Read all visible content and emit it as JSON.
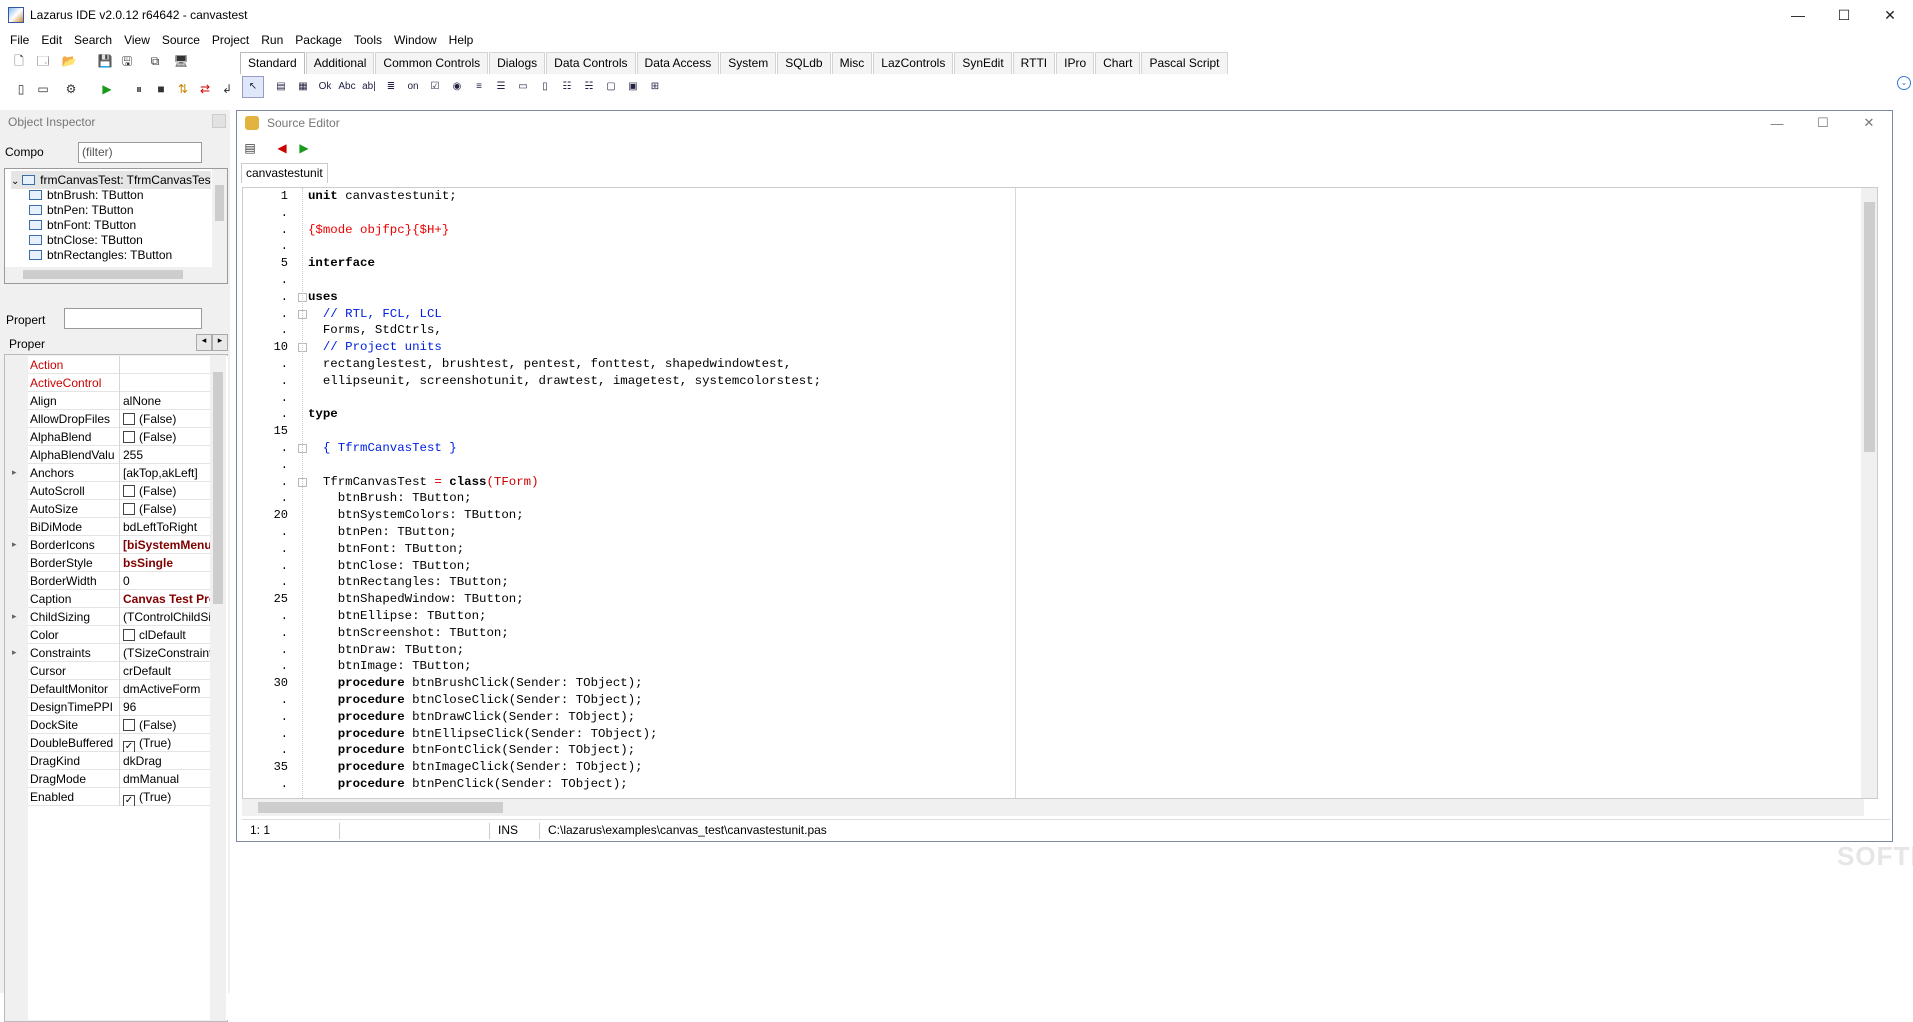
{
  "window": {
    "title": "Lazarus IDE v2.0.12 r64642 - canvastest",
    "min": "—",
    "max": "☐",
    "close": "✕"
  },
  "menu": [
    "File",
    "Edit",
    "Search",
    "View",
    "Source",
    "Project",
    "Run",
    "Package",
    "Tools",
    "Window",
    "Help"
  ],
  "palette": {
    "tabs": [
      "Standard",
      "Additional",
      "Common Controls",
      "Dialogs",
      "Data Controls",
      "Data Access",
      "System",
      "SQLdb",
      "Misc",
      "LazControls",
      "SynEdit",
      "RTTI",
      "IPro",
      "Chart",
      "Pascal Script"
    ],
    "icons": [
      "arrow-cursor-icon",
      "tmainmenu-icon",
      "tpopupmenu-icon",
      "tbutton-icon",
      "tlabel-icon",
      "tedit-icon",
      "tmemo-icon",
      "ttogglebox-icon",
      "tcheckbox-icon",
      "tradiobutton-icon",
      "tlistbox-icon",
      "tcombobox-icon",
      "tscrollbar-icon",
      "tgroupbox-icon",
      "tradiogroup-icon",
      "tcheckgroup-icon",
      "tpanel-icon",
      "tframe-icon",
      "tactionlist-icon"
    ],
    "icon_glyphs": [
      "↖",
      "▤",
      "▦",
      "Ok",
      "Abc",
      "ab|",
      "≣",
      "on",
      "☑",
      "◉",
      "≡",
      "☰",
      "▭",
      "▯",
      "☷",
      "☵",
      "▢",
      "▣",
      "⊞"
    ]
  },
  "object_inspector": {
    "title": "Object Inspector",
    "components_label": "Compo",
    "filter_placeholder": "(filter)",
    "properties_label": "Propert",
    "tab_label": "Proper",
    "tree": [
      "frmCanvasTest: TfrmCanvasTes",
      "btnBrush: TButton",
      "btnPen: TButton",
      "btnFont: TButton",
      "btnClose: TButton",
      "btnRectangles: TButton"
    ],
    "properties": [
      {
        "name": "Action",
        "value": "",
        "style": "red"
      },
      {
        "name": "ActiveControl",
        "value": "",
        "style": "red"
      },
      {
        "name": "Align",
        "value": "alNone"
      },
      {
        "name": "AllowDropFiles",
        "value": "(False)",
        "check": false
      },
      {
        "name": "AlphaBlend",
        "value": "(False)",
        "check": false
      },
      {
        "name": "AlphaBlendValu",
        "value": "255"
      },
      {
        "name": "Anchors",
        "value": "[akTop,akLeft]",
        "expand": true
      },
      {
        "name": "AutoScroll",
        "value": "(False)",
        "check": false
      },
      {
        "name": "AutoSize",
        "value": "(False)",
        "check": false
      },
      {
        "name": "BiDiMode",
        "value": "bdLeftToRight"
      },
      {
        "name": "BorderIcons",
        "value": "[biSystemMenu",
        "expand": true,
        "bold": true
      },
      {
        "name": "BorderStyle",
        "value": "bsSingle",
        "bold": true
      },
      {
        "name": "BorderWidth",
        "value": "0"
      },
      {
        "name": "Caption",
        "value": "Canvas Test Prog",
        "bold": true
      },
      {
        "name": "ChildSizing",
        "value": "(TControlChildSi",
        "expand": true
      },
      {
        "name": "Color",
        "value": "clDefault",
        "swatch": true
      },
      {
        "name": "Constraints",
        "value": "(TSizeConstraint",
        "expand": true
      },
      {
        "name": "Cursor",
        "value": "crDefault"
      },
      {
        "name": "DefaultMonitor",
        "value": "dmActiveForm"
      },
      {
        "name": "DesignTimePPI",
        "value": "96"
      },
      {
        "name": "DockSite",
        "value": "(False)",
        "check": false
      },
      {
        "name": "DoubleBuffered",
        "value": "(True)",
        "check": true
      },
      {
        "name": "DragKind",
        "value": "dkDrag"
      },
      {
        "name": "DragMode",
        "value": "dmManual"
      },
      {
        "name": "Enabled",
        "value": "(True)",
        "check": true
      }
    ]
  },
  "source_editor": {
    "title": "Source Editor",
    "tab": "canvastestunit",
    "lines": [
      {
        "n": "1",
        "t": [
          [
            "unit ",
            "kw"
          ],
          [
            "canvastestunit;",
            ""
          ]
        ]
      },
      {
        "n": ".",
        "t": []
      },
      {
        "n": ".",
        "t": [
          [
            "{$mode objfpc}{$H+}",
            "dir"
          ]
        ]
      },
      {
        "n": ".",
        "t": []
      },
      {
        "n": "5",
        "t": [
          [
            "interface",
            "kw"
          ]
        ]
      },
      {
        "n": ".",
        "t": []
      },
      {
        "n": ".",
        "t": [
          [
            "uses",
            "kw"
          ]
        ],
        "fold": true
      },
      {
        "n": ".",
        "t": [
          [
            "  // RTL, FCL, LCL",
            "cm"
          ]
        ],
        "fold": true
      },
      {
        "n": ".",
        "t": [
          [
            "  Forms, StdCtrls,",
            ""
          ]
        ]
      },
      {
        "n": "10",
        "t": [
          [
            "  // Project units",
            "cm"
          ]
        ],
        "fold": true
      },
      {
        "n": ".",
        "t": [
          [
            "  rectanglestest, brushtest, pentest, fonttest, shapedwindowtest,",
            ""
          ]
        ]
      },
      {
        "n": ".",
        "t": [
          [
            "  ellipseunit, screenshotunit, drawtest, imagetest, systemcolorstest;",
            ""
          ]
        ]
      },
      {
        "n": ".",
        "t": []
      },
      {
        "n": ".",
        "t": [
          [
            "type",
            "kw"
          ]
        ]
      },
      {
        "n": "15",
        "t": []
      },
      {
        "n": ".",
        "t": [
          [
            "  { TfrmCanvasTest }",
            "cm"
          ]
        ],
        "fold": true
      },
      {
        "n": ".",
        "t": []
      },
      {
        "n": ".",
        "t": [
          [
            "  TfrmCanvasTest ",
            ""
          ],
          [
            "= ",
            "sym"
          ],
          [
            "class",
            "kw"
          ],
          [
            "(TForm)",
            "sym"
          ]
        ],
        "fold": true
      },
      {
        "n": ".",
        "t": [
          [
            "    btnBrush: TButton;",
            ""
          ]
        ]
      },
      {
        "n": "20",
        "t": [
          [
            "    btnSystemColors: TButton;",
            ""
          ]
        ]
      },
      {
        "n": ".",
        "t": [
          [
            "    btnPen: TButton;",
            ""
          ]
        ]
      },
      {
        "n": ".",
        "t": [
          [
            "    btnFont: TButton;",
            ""
          ]
        ]
      },
      {
        "n": ".",
        "t": [
          [
            "    btnClose: TButton;",
            ""
          ]
        ]
      },
      {
        "n": ".",
        "t": [
          [
            "    btnRectangles: TButton;",
            ""
          ]
        ]
      },
      {
        "n": "25",
        "t": [
          [
            "    btnShapedWindow: TButton;",
            ""
          ]
        ]
      },
      {
        "n": ".",
        "t": [
          [
            "    btnEllipse: TButton;",
            ""
          ]
        ]
      },
      {
        "n": ".",
        "t": [
          [
            "    btnScreenshot: TButton;",
            ""
          ]
        ]
      },
      {
        "n": ".",
        "t": [
          [
            "    btnDraw: TButton;",
            ""
          ]
        ]
      },
      {
        "n": ".",
        "t": [
          [
            "    btnImage: TButton;",
            ""
          ]
        ]
      },
      {
        "n": "30",
        "t": [
          [
            "    procedure ",
            "kw"
          ],
          [
            "btnBrushClick(Sender: TObject);",
            ""
          ]
        ]
      },
      {
        "n": ".",
        "t": [
          [
            "    procedure ",
            "kw"
          ],
          [
            "btnCloseClick(Sender: TObject);",
            ""
          ]
        ]
      },
      {
        "n": ".",
        "t": [
          [
            "    procedure ",
            "kw"
          ],
          [
            "btnDrawClick(Sender: TObject);",
            ""
          ]
        ]
      },
      {
        "n": ".",
        "t": [
          [
            "    procedure ",
            "kw"
          ],
          [
            "btnEllipseClick(Sender: TObject);",
            ""
          ]
        ]
      },
      {
        "n": ".",
        "t": [
          [
            "    procedure ",
            "kw"
          ],
          [
            "btnFontClick(Sender: TObject);",
            ""
          ]
        ]
      },
      {
        "n": "35",
        "t": [
          [
            "    procedure ",
            "kw"
          ],
          [
            "btnImageClick(Sender: TObject);",
            ""
          ]
        ]
      },
      {
        "n": ".",
        "t": [
          [
            "    procedure ",
            "kw"
          ],
          [
            "btnPenClick(Sender: TObject);",
            ""
          ]
        ]
      }
    ]
  },
  "status": {
    "position": "1:  1",
    "mode": "INS",
    "file": "C:\\lazarus\\examples\\canvas_test\\canvastestunit.pas"
  },
  "watermark": "SOFTPEDIA",
  "colors": {
    "keyword": "#000000",
    "directive": "#ee0000",
    "comment": "#0020e0",
    "modified_prop": "#c00000"
  }
}
